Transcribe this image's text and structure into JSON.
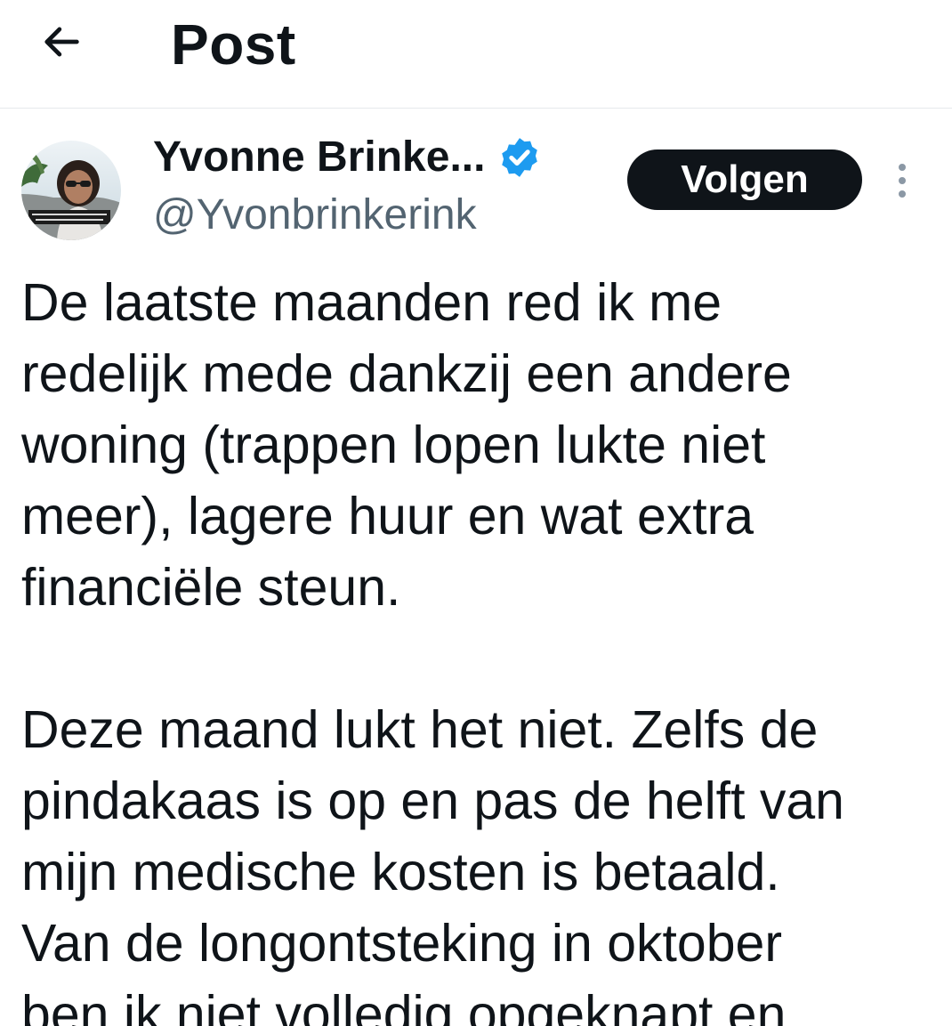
{
  "header": {
    "title": "Post",
    "back_icon": "arrow-left-icon"
  },
  "author": {
    "display_name": "Yvonne Brinke...",
    "handle": "@Yvonbrinkerink",
    "verified": true,
    "verified_color": "#1d9bf0",
    "avatar_icon": "profile-photo"
  },
  "actions": {
    "follow_label": "Volgen",
    "more_icon": "more-vertical-icon"
  },
  "post": {
    "paragraph_1": "De laatste maanden red ik me\nredelijk mede dankzij een andere\nwoning (trappen lopen lukte niet\nmeer), lagere huur en wat extra\nfinanciële steun.",
    "paragraph_2": "Deze maand lukt het niet. Zelfs de\npindakaas is op en pas de helft van\nmijn medische kosten is betaald.\nVan de longontsteking in oktober\nben ik niet volledig opgeknapt en"
  },
  "colors": {
    "text": "#0f1419",
    "secondary_text": "#536471",
    "divider": "#e6e9ec",
    "button_bg": "#0f1419",
    "button_text": "#ffffff"
  }
}
